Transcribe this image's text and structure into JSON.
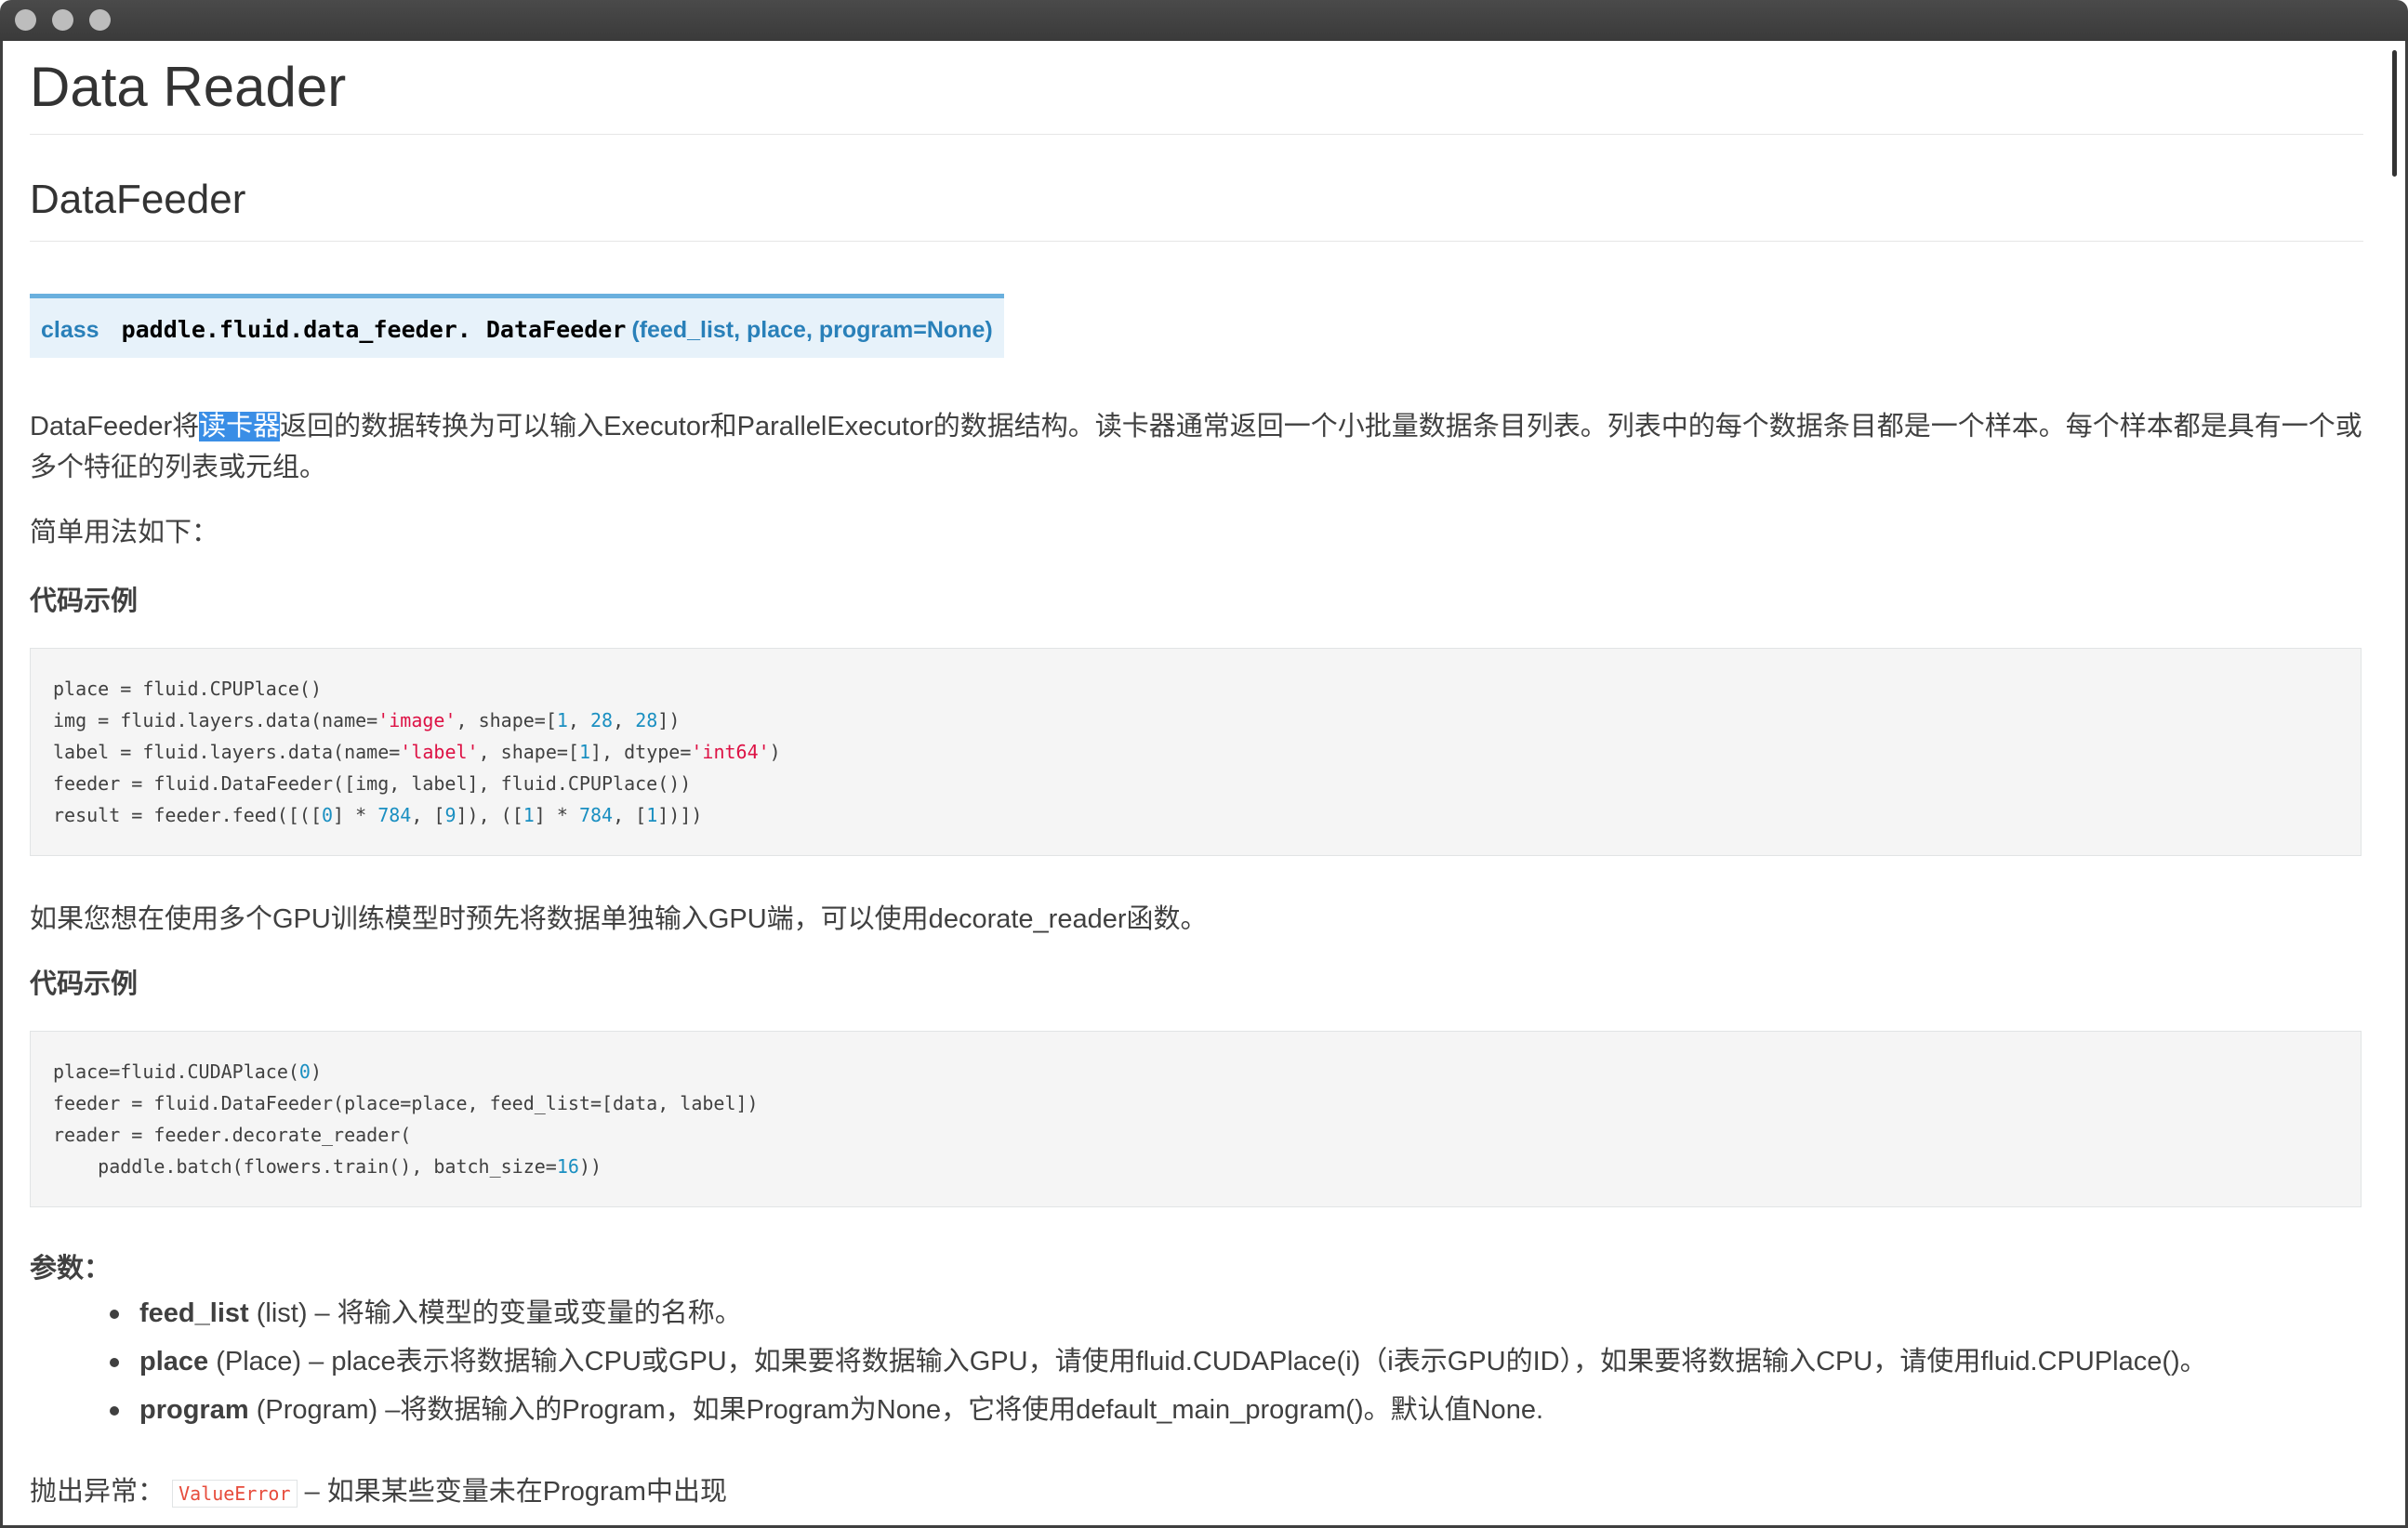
{
  "page": {
    "title": "Data Reader",
    "section": "DataFeeder"
  },
  "signature": {
    "keyword": "class",
    "module": "paddle.fluid.data_feeder.",
    "name": "DataFeeder",
    "params": "(feed_list, place, program=None)"
  },
  "intro": {
    "before": "DataFeeder将",
    "highlight": "读卡器",
    "after": "返回的数据转换为可以输入Executor和ParallelExecutor的数据结构。读卡器通常返回一个小批量数据条目列表。列表中的每个数据条目都是一个样本。每个样本都是具有一个或多个特征的列表或元组。"
  },
  "simple_usage": "简单用法如下：",
  "example_label": "代码示例",
  "gpu_note": "如果您想在使用多个GPU训练模型时预先将数据单独输入GPU端，可以使用decorate_reader函数。",
  "params": {
    "label": "参数：",
    "items": [
      {
        "name": "feed_list",
        "type": "(list)",
        "desc": " – 将输入模型的变量或变量的名称。"
      },
      {
        "name": "place",
        "type": "(Place)",
        "desc": " – place表示将数据输入CPU或GPU，如果要将数据输入GPU，请使用fluid.CUDAPlace(i)（i表示GPU的ID），如果要将数据输入CPU，请使用fluid.CPUPlace()。"
      },
      {
        "name": "program",
        "type": "(Program)",
        "desc": " –将数据输入的Program，如果Program为None，它将使用default_main_program()。默认值None."
      }
    ]
  },
  "raises": {
    "label": "抛出异常：",
    "code": "ValueError",
    "desc": "– 如果某些变量未在Program中出现"
  }
}
